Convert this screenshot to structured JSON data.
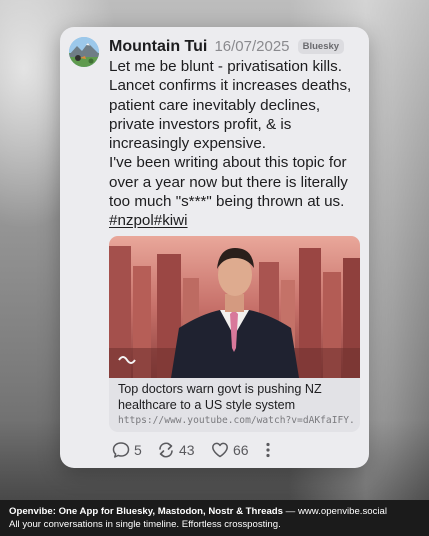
{
  "post": {
    "author_name": "Mountain Tui",
    "date": "16/07/2025",
    "network_badge": "Bluesky",
    "avatar_icon": "avatar-icon",
    "text_lines": [
      "Let me be blunt - privatisation kills.",
      "Lancet confirms it increases deaths,",
      "patient care inevitably declines,",
      "private investors profit, & is",
      "increasingly expensive."
    ],
    "text_paragraph2": "I've been writing about this topic for over a year now but there is literally too much \"s***\" being thrown at us.",
    "hashtags": [
      "#nzpol",
      "#kiwi"
    ],
    "link_preview": {
      "title": "Top doctors warn govt is pushing NZ healthcare to a US style system",
      "url": "https://www.youtube.com/watch?v=dAKfaIFY...",
      "thumbnail_icon": "video-thumbnail-icon"
    },
    "actions": {
      "replies": "5",
      "reposts": "43",
      "likes": "66"
    }
  },
  "footer": {
    "brand_line": "Openvibe: One App for Bluesky, Mastodon, Nostr & Threads",
    "separator": "—",
    "website": "www.openvibe.social",
    "tagline": "All your conversations in single timeline. Effortless crossposting."
  },
  "colors": {
    "card_background": "#ececef",
    "text_primary": "#1d1d1f",
    "text_secondary": "#8a8a8e",
    "footer_background": "#1b1b1b"
  }
}
